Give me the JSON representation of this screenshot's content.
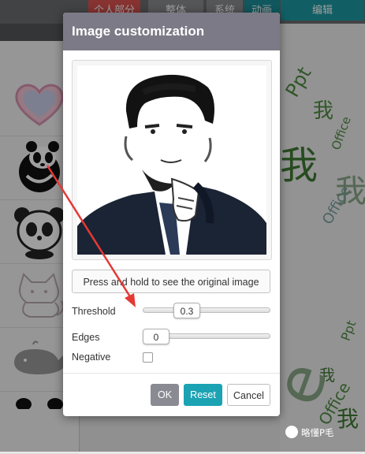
{
  "background": {
    "top_buttons": [
      "个人部分",
      "整体",
      "系统",
      "动画",
      "编辑"
    ],
    "word_cloud_words": [
      "我",
      "Ppt",
      "Office",
      "我",
      "我",
      "Ppt",
      "Office",
      "我",
      "e",
      "Office",
      "我"
    ]
  },
  "dialog": {
    "title": "Image customization",
    "press_button_label": "Press and hold to see the original image",
    "threshold": {
      "label": "Threshold",
      "value": "0.3",
      "fraction": 0.3
    },
    "edges": {
      "label": "Edges",
      "value": "0",
      "fraction": 0
    },
    "negative": {
      "label": "Negative",
      "checked": false
    },
    "buttons": {
      "ok": "OK",
      "reset": "Reset",
      "cancel": "Cancel"
    }
  },
  "watermark": {
    "text": "略懂P毛"
  },
  "colors": {
    "header": "#7b7a86",
    "reset": "#1ba3b4",
    "annotation_arrow": "#e53935"
  },
  "icons": [
    "heart-icon",
    "panda-icon",
    "panda-cartoon-icon",
    "cat-icon",
    "whale-icon",
    "panda-ears-icon",
    "wechat-icon"
  ]
}
